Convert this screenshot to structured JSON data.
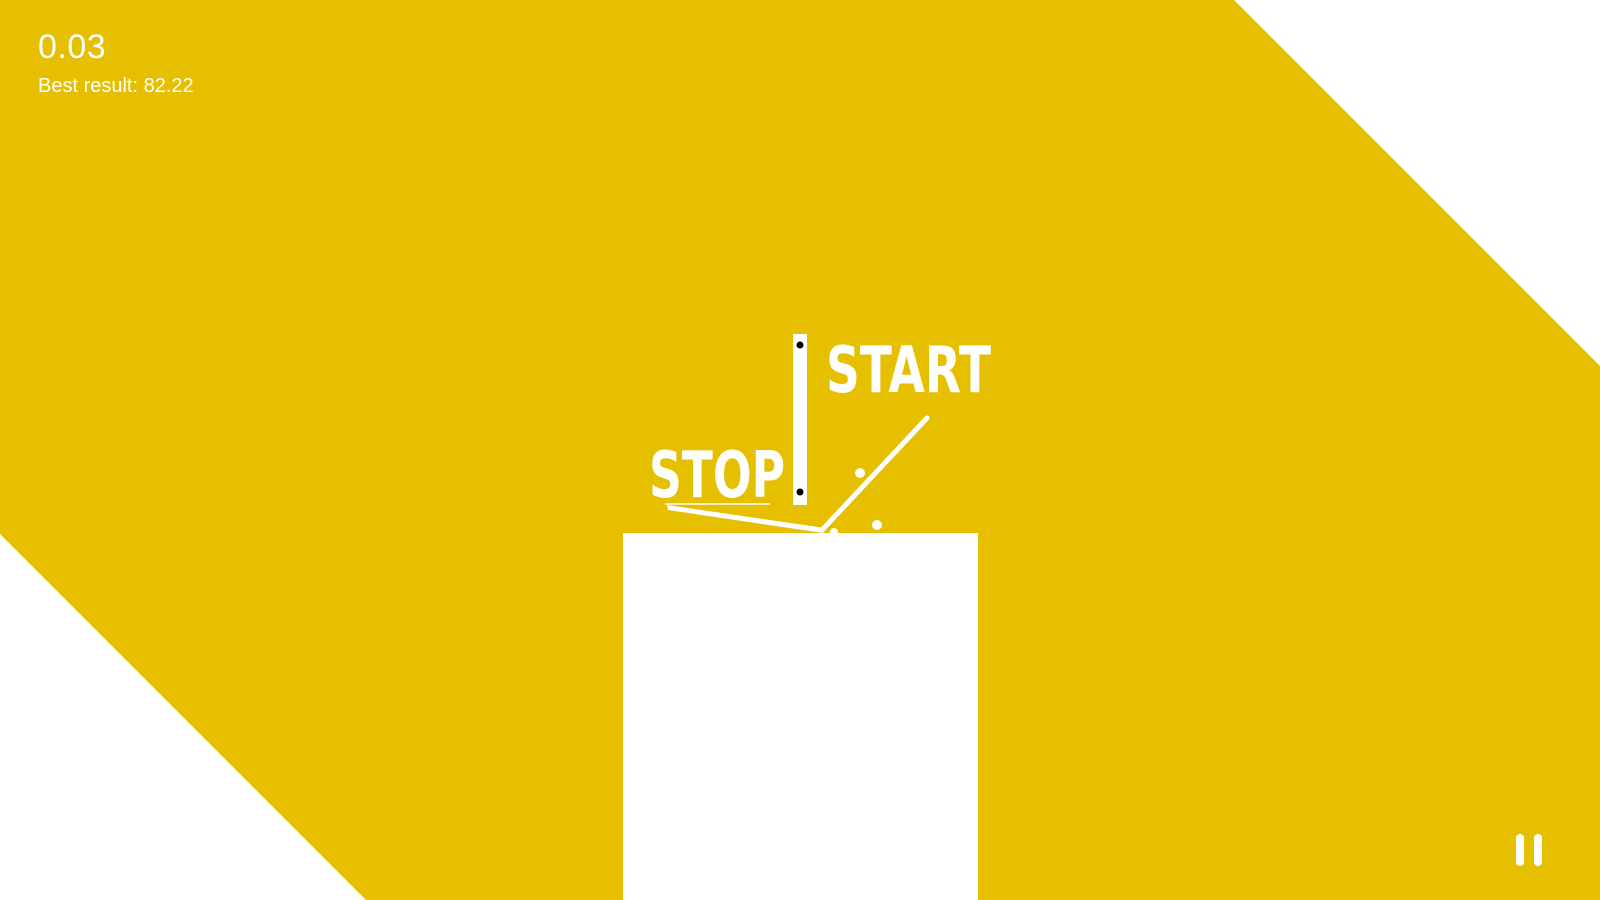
{
  "hud": {
    "timer": "0.03",
    "best_result": "Best result: 82.22"
  },
  "signs": {
    "start_label": "START",
    "stop_label": "STOP"
  },
  "colors": {
    "background": "#E5BF00",
    "foreground": "#FFFFFF",
    "hinge": "#000000"
  },
  "icons": {
    "pause": "pause-icon"
  }
}
